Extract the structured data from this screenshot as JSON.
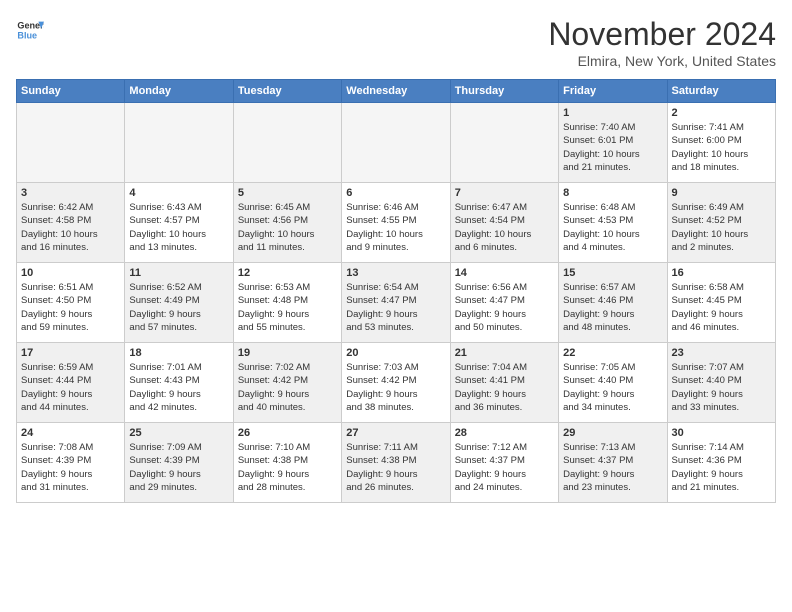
{
  "header": {
    "logo_general": "General",
    "logo_blue": "Blue",
    "month_title": "November 2024",
    "location": "Elmira, New York, United States"
  },
  "weekdays": [
    "Sunday",
    "Monday",
    "Tuesday",
    "Wednesday",
    "Thursday",
    "Friday",
    "Saturday"
  ],
  "rows": [
    [
      {
        "day": "",
        "info": "",
        "empty": true
      },
      {
        "day": "",
        "info": "",
        "empty": true
      },
      {
        "day": "",
        "info": "",
        "empty": true
      },
      {
        "day": "",
        "info": "",
        "empty": true
      },
      {
        "day": "",
        "info": "",
        "empty": true
      },
      {
        "day": "1",
        "info": "Sunrise: 7:40 AM\nSunset: 6:01 PM\nDaylight: 10 hours\nand 21 minutes.",
        "shaded": true
      },
      {
        "day": "2",
        "info": "Sunrise: 7:41 AM\nSunset: 6:00 PM\nDaylight: 10 hours\nand 18 minutes.",
        "shaded": false
      }
    ],
    [
      {
        "day": "3",
        "info": "Sunrise: 6:42 AM\nSunset: 4:58 PM\nDaylight: 10 hours\nand 16 minutes.",
        "shaded": true
      },
      {
        "day": "4",
        "info": "Sunrise: 6:43 AM\nSunset: 4:57 PM\nDaylight: 10 hours\nand 13 minutes.",
        "shaded": false
      },
      {
        "day": "5",
        "info": "Sunrise: 6:45 AM\nSunset: 4:56 PM\nDaylight: 10 hours\nand 11 minutes.",
        "shaded": true
      },
      {
        "day": "6",
        "info": "Sunrise: 6:46 AM\nSunset: 4:55 PM\nDaylight: 10 hours\nand 9 minutes.",
        "shaded": false
      },
      {
        "day": "7",
        "info": "Sunrise: 6:47 AM\nSunset: 4:54 PM\nDaylight: 10 hours\nand 6 minutes.",
        "shaded": true
      },
      {
        "day": "8",
        "info": "Sunrise: 6:48 AM\nSunset: 4:53 PM\nDaylight: 10 hours\nand 4 minutes.",
        "shaded": false
      },
      {
        "day": "9",
        "info": "Sunrise: 6:49 AM\nSunset: 4:52 PM\nDaylight: 10 hours\nand 2 minutes.",
        "shaded": true
      }
    ],
    [
      {
        "day": "10",
        "info": "Sunrise: 6:51 AM\nSunset: 4:50 PM\nDaylight: 9 hours\nand 59 minutes.",
        "shaded": false
      },
      {
        "day": "11",
        "info": "Sunrise: 6:52 AM\nSunset: 4:49 PM\nDaylight: 9 hours\nand 57 minutes.",
        "shaded": true
      },
      {
        "day": "12",
        "info": "Sunrise: 6:53 AM\nSunset: 4:48 PM\nDaylight: 9 hours\nand 55 minutes.",
        "shaded": false
      },
      {
        "day": "13",
        "info": "Sunrise: 6:54 AM\nSunset: 4:47 PM\nDaylight: 9 hours\nand 53 minutes.",
        "shaded": true
      },
      {
        "day": "14",
        "info": "Sunrise: 6:56 AM\nSunset: 4:47 PM\nDaylight: 9 hours\nand 50 minutes.",
        "shaded": false
      },
      {
        "day": "15",
        "info": "Sunrise: 6:57 AM\nSunset: 4:46 PM\nDaylight: 9 hours\nand 48 minutes.",
        "shaded": true
      },
      {
        "day": "16",
        "info": "Sunrise: 6:58 AM\nSunset: 4:45 PM\nDaylight: 9 hours\nand 46 minutes.",
        "shaded": false
      }
    ],
    [
      {
        "day": "17",
        "info": "Sunrise: 6:59 AM\nSunset: 4:44 PM\nDaylight: 9 hours\nand 44 minutes.",
        "shaded": true
      },
      {
        "day": "18",
        "info": "Sunrise: 7:01 AM\nSunset: 4:43 PM\nDaylight: 9 hours\nand 42 minutes.",
        "shaded": false
      },
      {
        "day": "19",
        "info": "Sunrise: 7:02 AM\nSunset: 4:42 PM\nDaylight: 9 hours\nand 40 minutes.",
        "shaded": true
      },
      {
        "day": "20",
        "info": "Sunrise: 7:03 AM\nSunset: 4:42 PM\nDaylight: 9 hours\nand 38 minutes.",
        "shaded": false
      },
      {
        "day": "21",
        "info": "Sunrise: 7:04 AM\nSunset: 4:41 PM\nDaylight: 9 hours\nand 36 minutes.",
        "shaded": true
      },
      {
        "day": "22",
        "info": "Sunrise: 7:05 AM\nSunset: 4:40 PM\nDaylight: 9 hours\nand 34 minutes.",
        "shaded": false
      },
      {
        "day": "23",
        "info": "Sunrise: 7:07 AM\nSunset: 4:40 PM\nDaylight: 9 hours\nand 33 minutes.",
        "shaded": true
      }
    ],
    [
      {
        "day": "24",
        "info": "Sunrise: 7:08 AM\nSunset: 4:39 PM\nDaylight: 9 hours\nand 31 minutes.",
        "shaded": false
      },
      {
        "day": "25",
        "info": "Sunrise: 7:09 AM\nSunset: 4:39 PM\nDaylight: 9 hours\nand 29 minutes.",
        "shaded": true
      },
      {
        "day": "26",
        "info": "Sunrise: 7:10 AM\nSunset: 4:38 PM\nDaylight: 9 hours\nand 28 minutes.",
        "shaded": false
      },
      {
        "day": "27",
        "info": "Sunrise: 7:11 AM\nSunset: 4:38 PM\nDaylight: 9 hours\nand 26 minutes.",
        "shaded": true
      },
      {
        "day": "28",
        "info": "Sunrise: 7:12 AM\nSunset: 4:37 PM\nDaylight: 9 hours\nand 24 minutes.",
        "shaded": false
      },
      {
        "day": "29",
        "info": "Sunrise: 7:13 AM\nSunset: 4:37 PM\nDaylight: 9 hours\nand 23 minutes.",
        "shaded": true
      },
      {
        "day": "30",
        "info": "Sunrise: 7:14 AM\nSunset: 4:36 PM\nDaylight: 9 hours\nand 21 minutes.",
        "shaded": false
      }
    ]
  ]
}
